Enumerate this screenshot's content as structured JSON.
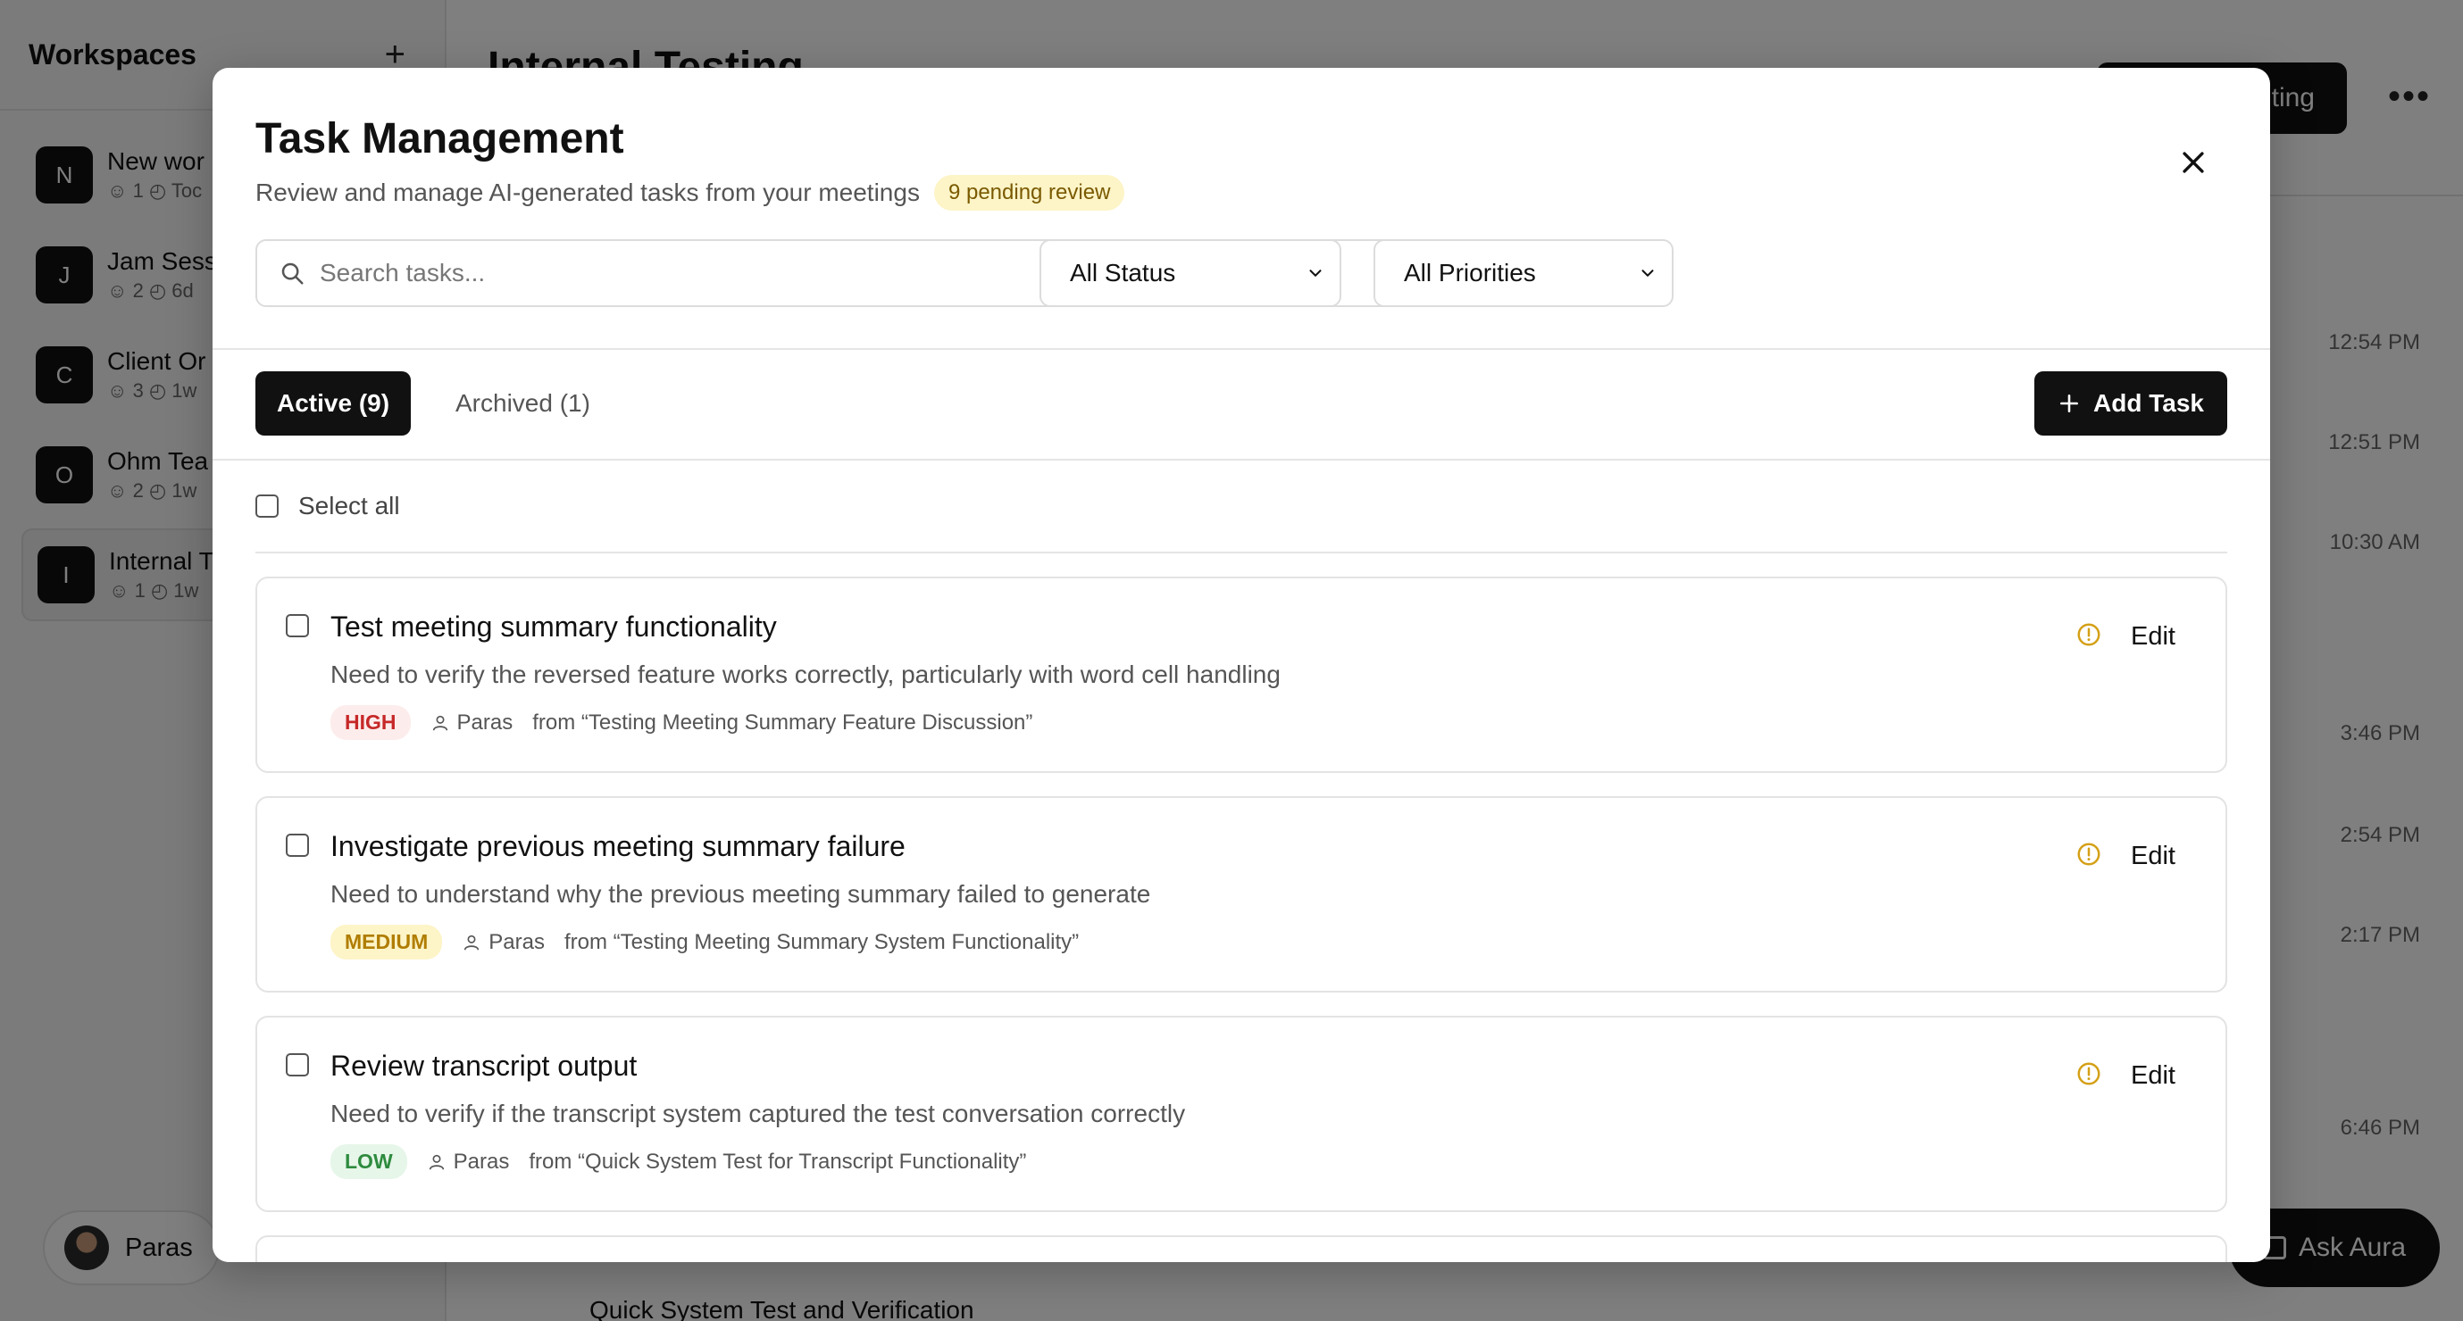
{
  "sidebar": {
    "title": "Workspaces",
    "add_symbol": "+",
    "workspaces": [
      {
        "initial": "N",
        "name": "New wor",
        "members": "1",
        "time": "Toc"
      },
      {
        "initial": "J",
        "name": "Jam Sess",
        "members": "2",
        "time": "6d"
      },
      {
        "initial": "C",
        "name": "Client Or",
        "members": "3",
        "time": "1w"
      },
      {
        "initial": "O",
        "name": "Ohm Tea",
        "members": "2",
        "time": "1w"
      },
      {
        "initial": "I",
        "name": "Internal T",
        "members": "1",
        "time": "1w"
      }
    ],
    "user": {
      "name": "Paras"
    }
  },
  "main": {
    "title": "Internal Testing",
    "primary_button": "ting",
    "more_symbol": "•••",
    "times": [
      "12:54 PM",
      "12:51 PM",
      "10:30 AM",
      "3:46 PM",
      "2:54 PM",
      "2:17 PM",
      "6:46 PM"
    ],
    "bottom_item": "Quick System Test and Verification",
    "ask_button": "Ask Aura"
  },
  "modal": {
    "title": "Task Management",
    "subtitle": "Review and manage AI-generated tasks from your meetings",
    "pending_badge": "9 pending review",
    "search_placeholder": "Search tasks...",
    "status_filter": "All Status",
    "priority_filter": "All Priorities",
    "tabs": {
      "active": "Active (9)",
      "archived": "Archived (1)"
    },
    "add_task": "Add Task",
    "select_all": "Select all",
    "edit_label": "Edit",
    "tasks": [
      {
        "title": "Test meeting summary functionality",
        "description": "Need to verify the reversed feature works correctly, particularly with word cell handling",
        "priority": "HIGH",
        "assignee": "Paras",
        "source": "from “Testing Meeting Summary Feature Discussion”"
      },
      {
        "title": "Investigate previous meeting summary failure",
        "description": "Need to understand why the previous meeting summary failed to generate",
        "priority": "MEDIUM",
        "assignee": "Paras",
        "source": "from “Testing Meeting Summary System Functionality”"
      },
      {
        "title": "Review transcript output",
        "description": "Need to verify if the transcript system captured the test conversation correctly",
        "priority": "LOW",
        "assignee": "Paras",
        "source": "from “Quick System Test for Transcript Functionality”"
      }
    ]
  },
  "colors": {
    "accent_dark": "#111111",
    "high": "#c62828",
    "medium": "#b07d00",
    "low": "#2e8b3e",
    "pending": "#d4a017"
  }
}
